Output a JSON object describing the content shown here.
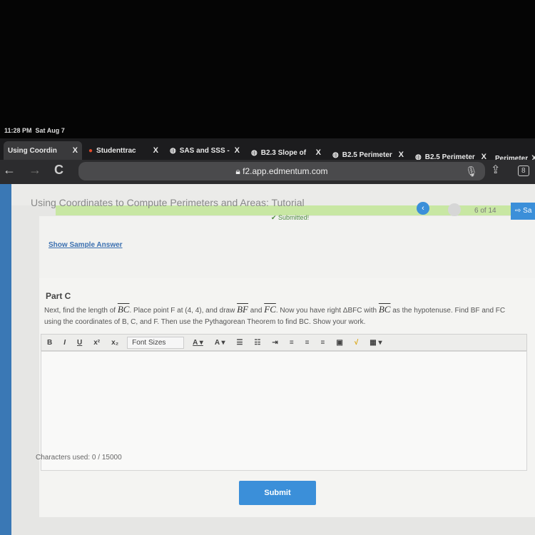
{
  "status": {
    "time": "11:28 PM",
    "date": "Sat Aug 7"
  },
  "tabs": [
    {
      "label": "Using Coordin",
      "close": "X"
    },
    {
      "label": "Studenttrac",
      "close": "X"
    },
    {
      "label": "SAS and SSS -",
      "close": "X"
    },
    {
      "label": "B2.3 Slope of",
      "close": "X"
    },
    {
      "label": "B2.5 Perimeter",
      "close": "X"
    },
    {
      "label": "B2.5 Perimeter",
      "close": "X"
    },
    {
      "label": "Perimeter",
      "close": "X"
    }
  ],
  "browser": {
    "url": "f2.app.edmentum.com",
    "tab_count": "8",
    "back": "←",
    "forward": "→",
    "reload": "C"
  },
  "header": {
    "title": "Using Coordinates to Compute Perimeters and Areas: Tutorial",
    "pager": "6 of 14",
    "save": "Sa",
    "prev": "‹"
  },
  "part_b": {
    "submitted": "Submitted!",
    "sample_link": "Show Sample Answer"
  },
  "part_c": {
    "heading": "Part C",
    "p1": "Next, find the length of ",
    "bc": "BC",
    "p2": ". Place point F at (4, 4), and draw ",
    "bf": "BF",
    "p3": " and ",
    "fc": "FC",
    "p4": ". Now you have right ΔBFC with ",
    "bc2": "BC",
    "p5": " as the hypotenuse. Find BF and FC using the coordinates of B, C, and F. Then use the Pythagorean Theorem to find BC. Show your work."
  },
  "toolbar": {
    "bold": "B",
    "italic": "I",
    "underline": "U",
    "sup": "x²",
    "sub": "x₂",
    "font_sizes": "Font Sizes",
    "font_color": "A ▾",
    "bg_color": "A ▾",
    "bullets": "☰",
    "numbers": "☷",
    "indent": "⇥",
    "left": "≡",
    "center": "≡",
    "right": "≡",
    "image": "▣",
    "math": "√",
    "table": "▦ ▾"
  },
  "editor": {
    "chars": "Characters used: 0 / 15000"
  },
  "submit": "Submit"
}
